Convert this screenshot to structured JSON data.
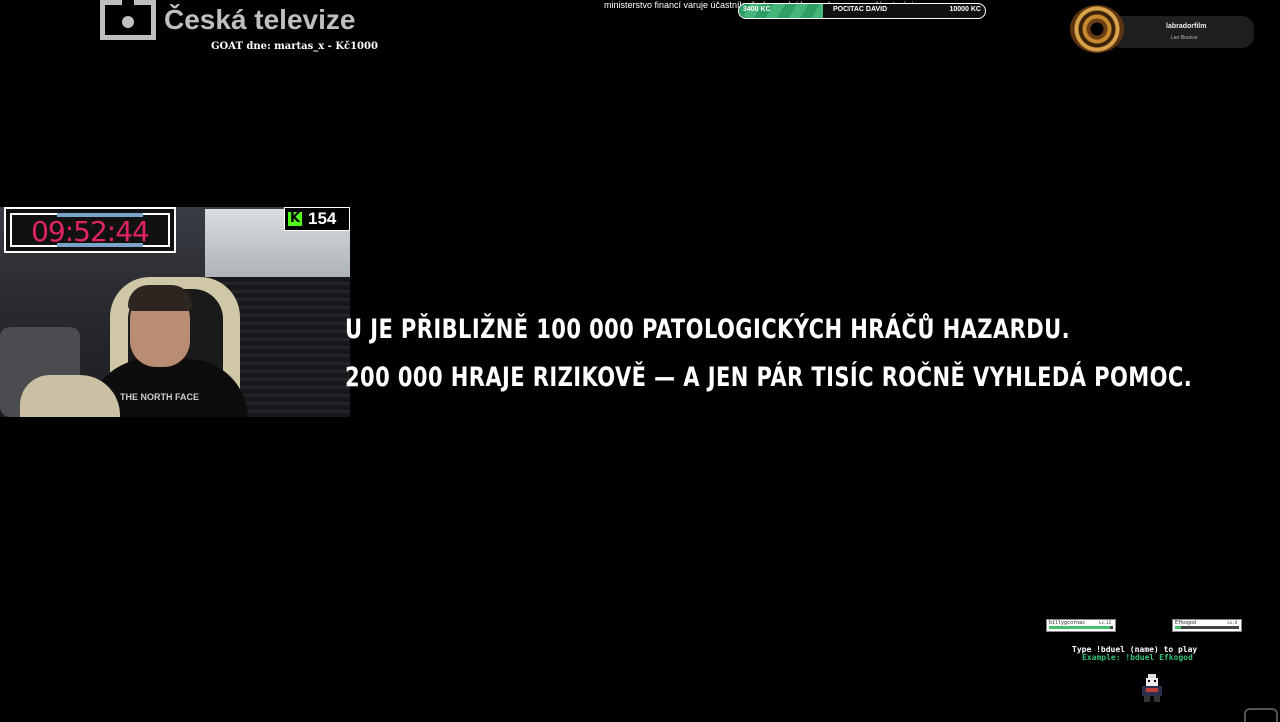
{
  "header": {
    "channel_name": "Česká televize",
    "goat_line": "GOAT dne: martas_x - Kč1000"
  },
  "ticker": {
    "text": "ministerstvo financí varuje účastníky že hazardní hry mohou ze vyvolávat závislost"
  },
  "goal": {
    "current": "3400 KC",
    "title": "POCITAC DAVID",
    "target": "10000 KC",
    "progress_fraction": 0.34,
    "fill_color": "#2f9e66"
  },
  "now_playing": {
    "title": "labradorfilm",
    "subtitle": "Leo Bounce",
    "art_icon": "vinyl-record-icon"
  },
  "webcam": {
    "timer": "09:52:44",
    "timer_color": "#e0245e",
    "viewer_count": "154",
    "platform_icon": "kick-icon",
    "platform_color": "#53fc18",
    "shirt_text": "THE NORTH FACE"
  },
  "subtitles": {
    "line1": "U JE PŘIBLIŽNĚ 100 000 PATOLOGICKÝCH HRÁČŮ HAZARDU.",
    "line2": "200 000 HRAJE RIZIKOVĚ — A JEN PÁR TISÍC ROČNĚ VYHLEDÁ POMOC."
  },
  "duel": {
    "player1": {
      "name": "billygcornac",
      "level": "Lv.13",
      "hp_fraction": 0.95,
      "hp_color": "#46c06a"
    },
    "player2": {
      "name": "Efkogod",
      "level": "Lv.4",
      "hp_fraction": 0.1,
      "hp_color": "#46c06a"
    },
    "help_text": "Type !bduel (name) to play",
    "example_text": "Example: !bduel Efkogod",
    "sprite_icon": "pixel-character-icon"
  }
}
